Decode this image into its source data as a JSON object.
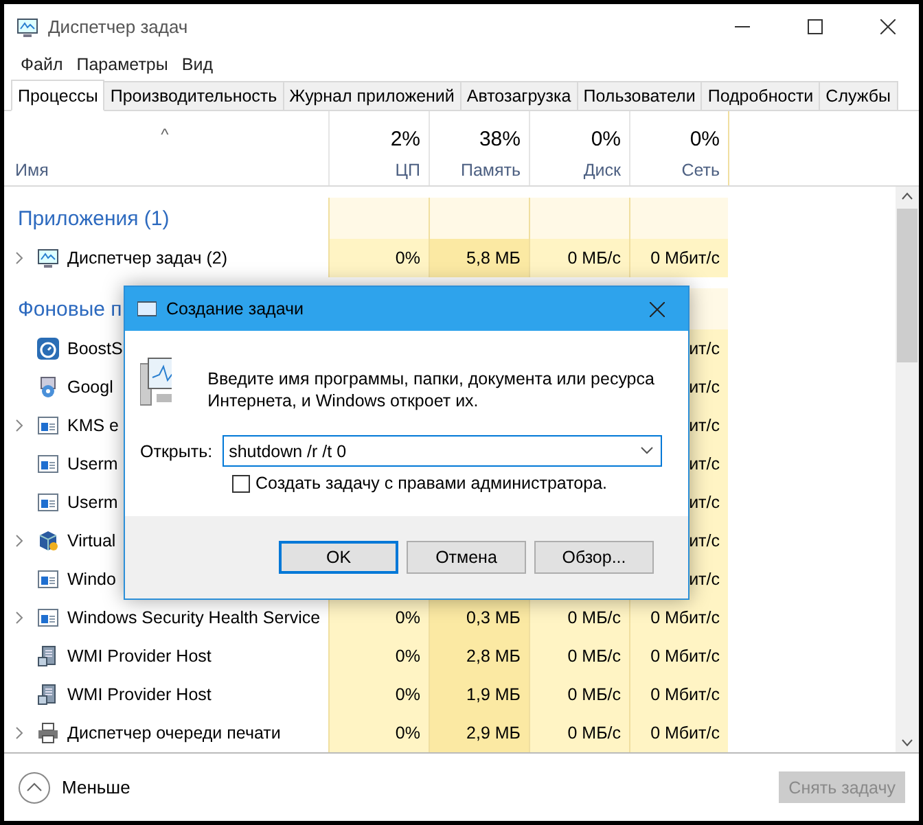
{
  "window": {
    "title": "Диспетчер задач"
  },
  "menu": [
    "Файл",
    "Параметры",
    "Вид"
  ],
  "tabs": [
    {
      "label": "Процессы",
      "selected": true
    },
    {
      "label": "Производительность",
      "selected": false
    },
    {
      "label": "Журнал приложений",
      "selected": false
    },
    {
      "label": "Автозагрузка",
      "selected": false
    },
    {
      "label": "Пользователи",
      "selected": false
    },
    {
      "label": "Подробности",
      "selected": false
    },
    {
      "label": "Службы",
      "selected": false
    }
  ],
  "table": {
    "sort_arrow": "^",
    "name_column": "Имя",
    "columns": [
      {
        "total": "2%",
        "label": "ЦП"
      },
      {
        "total": "38%",
        "label": "Память"
      },
      {
        "total": "0%",
        "label": "Диск"
      },
      {
        "total": "0%",
        "label": "Сеть"
      }
    ],
    "rows": [
      {
        "kind": "group",
        "name": "Приложения (1)"
      },
      {
        "kind": "monitor",
        "expandable": true,
        "name": "Диспетчер задач (2)",
        "cells": [
          "0%",
          "5,8 МБ",
          "0 МБ/с",
          "0 Мбит/с"
        ]
      },
      {
        "kind": "group",
        "name": "Фоновые п"
      },
      {
        "kind": "stopwatch",
        "expandable": false,
        "name": "BoostS",
        "cells": [
          "",
          "",
          "",
          "ит/с"
        ]
      },
      {
        "kind": "installer",
        "expandable": false,
        "name": "Googl",
        "cells": [
          "",
          "",
          "",
          "ит/с"
        ]
      },
      {
        "kind": "window",
        "expandable": true,
        "name": "KMS e",
        "cells": [
          "",
          "",
          "",
          "ит/с"
        ]
      },
      {
        "kind": "window",
        "expandable": false,
        "name": "Userm",
        "cells": [
          "",
          "",
          "",
          "ит/с"
        ]
      },
      {
        "kind": "window",
        "expandable": false,
        "name": "Userm",
        "cells": [
          "",
          "",
          "",
          "ит/с"
        ]
      },
      {
        "kind": "cube",
        "expandable": true,
        "name": "Virtual",
        "cells": [
          "",
          "",
          "",
          "ит/с"
        ]
      },
      {
        "kind": "window",
        "expandable": false,
        "name": "Windo",
        "cells": [
          "",
          "",
          "",
          "ит/с"
        ]
      },
      {
        "kind": "window",
        "expandable": true,
        "name": "Windows Security Health Service",
        "cells": [
          "0%",
          "0,3 МБ",
          "0 МБ/с",
          "0 Мбит/с"
        ]
      },
      {
        "kind": "server",
        "expandable": false,
        "name": "WMI Provider Host",
        "cells": [
          "0%",
          "2,8 МБ",
          "0 МБ/с",
          "0 Мбит/с"
        ]
      },
      {
        "kind": "server",
        "expandable": false,
        "name": "WMI Provider Host",
        "cells": [
          "0%",
          "1,9 МБ",
          "0 МБ/с",
          "0 Мбит/с"
        ]
      },
      {
        "kind": "printer",
        "expandable": true,
        "name": "Диспетчер очереди печати",
        "cells": [
          "0%",
          "2,9 МБ",
          "0 МБ/с",
          "0 Мбит/с"
        ]
      }
    ]
  },
  "footer": {
    "less": "Меньше",
    "end_task": {
      "label": "Снять задачу",
      "disabled": true
    }
  },
  "dialog": {
    "title": "Создание задачи",
    "message": "Введите имя программы, папки, документа или ресурса Интернета, и Windows откроет их.",
    "open_label": "Открыть:",
    "open_value": "shutdown /r /t 0",
    "admin_checkbox": {
      "label": "Создать задачу с правами администратора.",
      "checked": false
    },
    "buttons": [
      {
        "label": "OK",
        "focused": true
      },
      {
        "label": "Отмена",
        "focused": false
      },
      {
        "label": "Обзор...",
        "focused": false
      }
    ]
  }
}
